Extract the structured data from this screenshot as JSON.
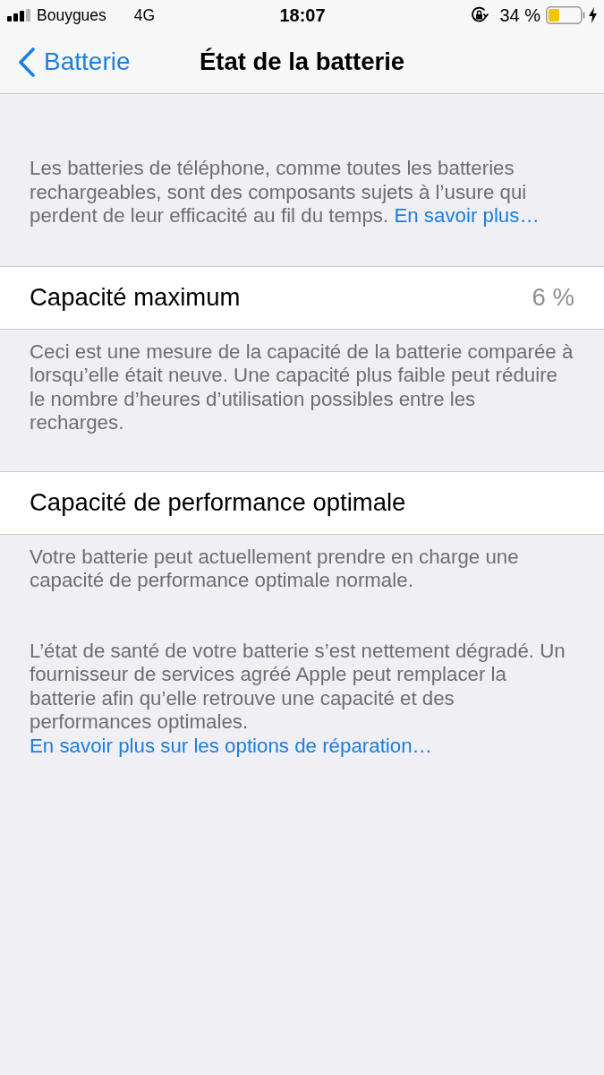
{
  "status_bar": {
    "carrier": "Bouygues",
    "network": "4G",
    "time": "18:07",
    "battery_percent": "34 %"
  },
  "nav": {
    "back_label": "Batterie",
    "title": "État de la batterie"
  },
  "intro": {
    "text": "Les batteries de téléphone, comme toutes les batteries rechargeables, sont des composants sujets à l’usure qui perdent de leur efficacité au fil du temps.",
    "link": "En savoir plus…"
  },
  "sections": [
    {
      "label": "Capacité maximum",
      "value": "6 %",
      "footer": "Ceci est une mesure de la capacité de la batterie comparée à lorsqu’elle était neuve. Une capacité plus faible peut réduire le nombre d’heures d’utilisation possibles entre les recharges."
    },
    {
      "label": "Capacité de performance optimale",
      "footer": "Votre batterie peut actuellement prendre en charge une capacité de performance optimale normale."
    }
  ],
  "notice": {
    "text": "L’état de santé de votre batterie s’est nettement dégradé. Un fournisseur de services agréé Apple peut remplacer la batterie afin qu’elle retrouve une capacité et des performances optimales.",
    "link": "En savoir plus sur les options de réparation…"
  }
}
